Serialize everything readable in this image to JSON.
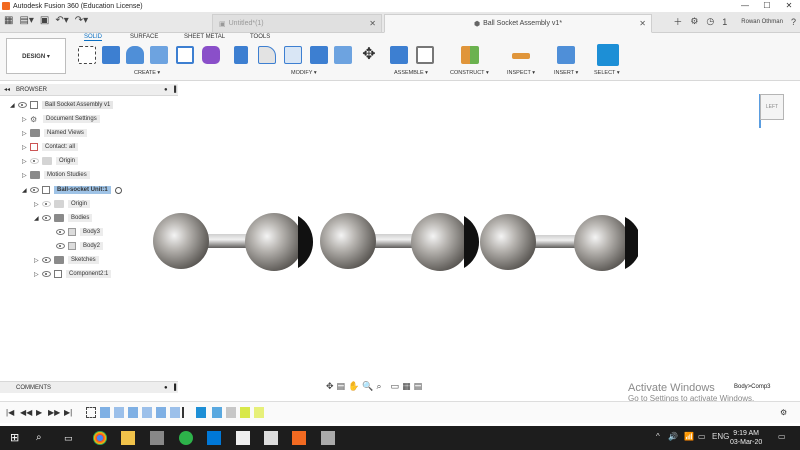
{
  "window": {
    "title": "Autodesk Fusion 360 (Education License)",
    "controls": [
      "—",
      "☐",
      "✕"
    ]
  },
  "tabs": [
    {
      "label": "Untitled*(1)",
      "active": false
    },
    {
      "label": "Ball Socket Assembly v1*",
      "active": true
    }
  ],
  "user": {
    "name": "Rowan Othman",
    "job_count": "1"
  },
  "toolbar": {
    "workspace": "DESIGN ▾",
    "workspace_tabs": [
      "SOLID",
      "SURFACE",
      "SHEET METAL",
      "TOOLS"
    ],
    "groups": [
      "CREATE ▾",
      "MODIFY ▾",
      "ASSEMBLE ▾",
      "CONSTRUCT ▾",
      "INSPECT ▾",
      "INSERT ▾",
      "SELECT ▾"
    ]
  },
  "browser": {
    "title": "BROWSER",
    "items": [
      {
        "label": "Ball Socket Assembly v1",
        "level": 0
      },
      {
        "label": "Document Settings",
        "level": 1
      },
      {
        "label": "Named Views",
        "level": 1
      },
      {
        "label": "Contact: all",
        "level": 1
      },
      {
        "label": "Origin",
        "level": 1
      },
      {
        "label": "Motion Studies",
        "level": 1
      },
      {
        "label": "Ball-socket Unit:1",
        "level": 1
      },
      {
        "label": "Origin",
        "level": 2
      },
      {
        "label": "Bodies",
        "level": 2
      },
      {
        "label": "Body3",
        "level": 3
      },
      {
        "label": "Body2",
        "level": 3
      },
      {
        "label": "Sketches",
        "level": 2
      },
      {
        "label": "Component2:1",
        "level": 2
      }
    ]
  },
  "comments": {
    "title": "COMMENTS"
  },
  "viewcube": {
    "label": "LEFT"
  },
  "watermark": {
    "line1": "Activate Windows",
    "line2": "Go to Settings to activate Windows."
  },
  "status": {
    "selection": "Body>Comp3"
  },
  "taskbar": {
    "time": "9:19 AM",
    "date": "03-Mar-20",
    "language": "ENG"
  },
  "colors": {
    "accent": "#0a6fc2",
    "toolbar_bg": "#f7f7f7",
    "taskbar_bg": "#1d1d1d",
    "selection": "#9fc3e6"
  }
}
